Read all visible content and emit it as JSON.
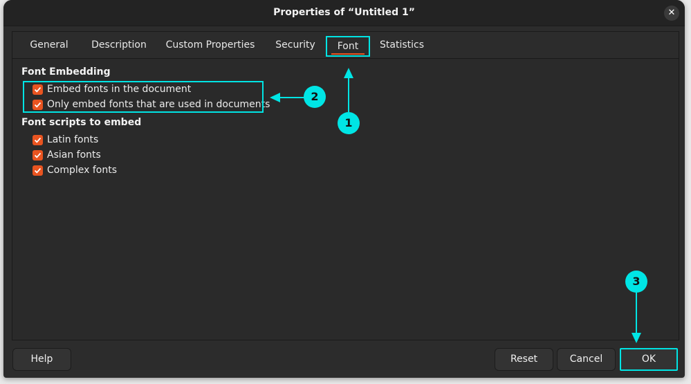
{
  "window": {
    "title": "Properties of “Untitled 1”",
    "close_glyph": "✕"
  },
  "tabs": [
    {
      "label": "General",
      "active": false
    },
    {
      "label": "Description",
      "active": false
    },
    {
      "label": "Custom Properties",
      "active": false
    },
    {
      "label": "Security",
      "active": false
    },
    {
      "label": "Font",
      "active": true
    },
    {
      "label": "Statistics",
      "active": false
    }
  ],
  "font_embedding": {
    "heading": "Font Embedding",
    "options": [
      {
        "label": "Embed fonts in the document",
        "checked": true
      },
      {
        "label": "Only embed fonts that are used in documents",
        "checked": true
      }
    ]
  },
  "font_scripts": {
    "heading": "Font scripts to embed",
    "options": [
      {
        "label": "Latin fonts",
        "checked": true
      },
      {
        "label": "Asian fonts",
        "checked": true
      },
      {
        "label": "Complex fonts",
        "checked": true
      }
    ]
  },
  "buttons": {
    "help": "Help",
    "reset": "Reset",
    "cancel": "Cancel",
    "ok": "OK"
  },
  "annotations": [
    {
      "number": "1",
      "target": "Font tab"
    },
    {
      "number": "2",
      "target": "Font Embedding options"
    },
    {
      "number": "3",
      "target": "OK button"
    }
  ],
  "colors": {
    "accent_checkbox": "#e95420",
    "annotation": "#00e5e5",
    "dialog_bg": "#2c2c2c"
  }
}
